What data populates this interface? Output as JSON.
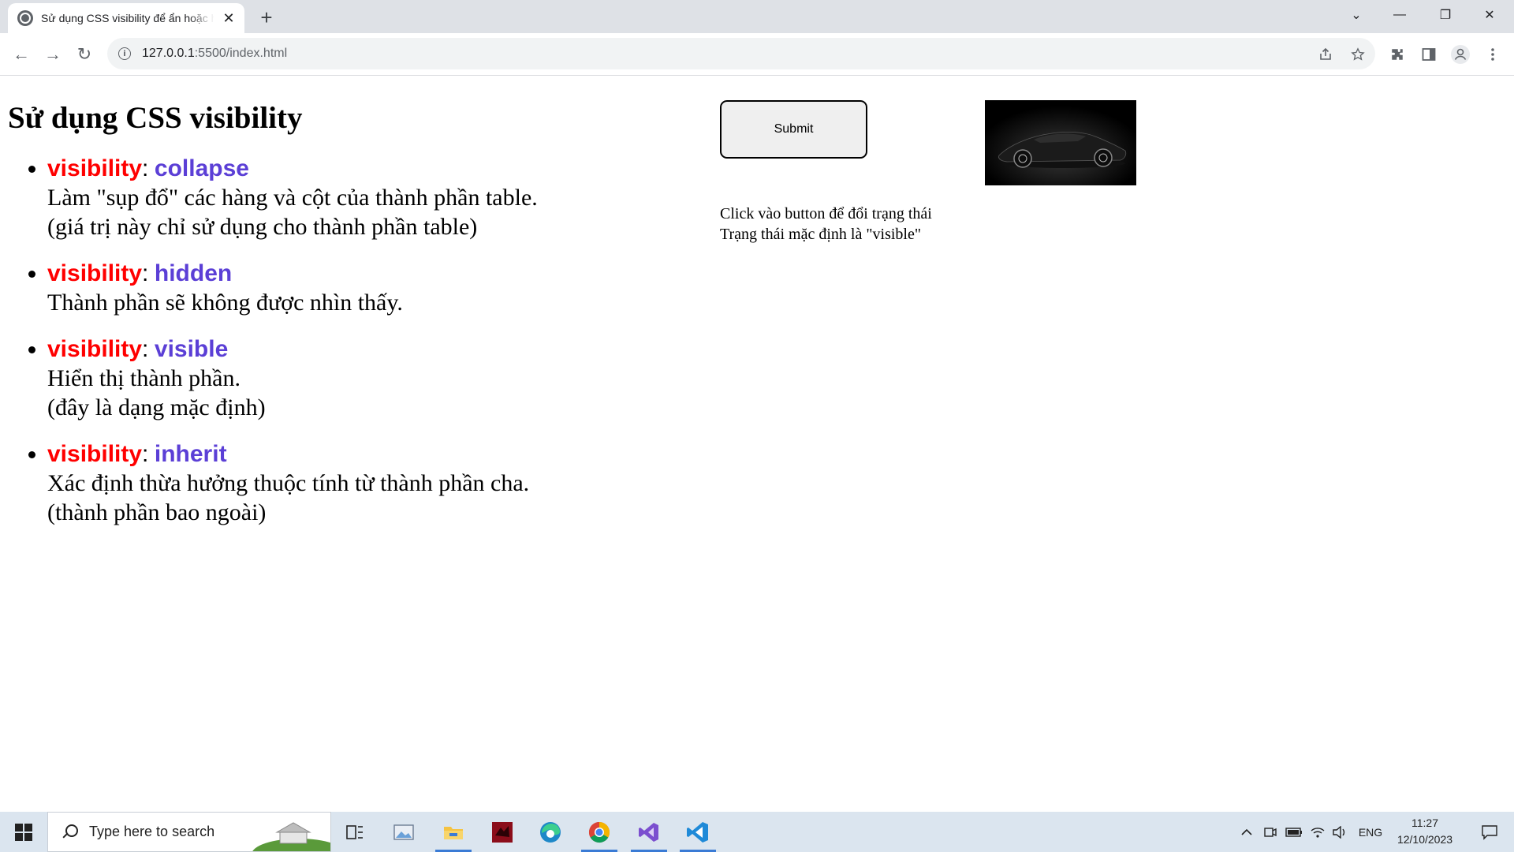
{
  "browser": {
    "tab_title": "Sử dụng CSS visibility để ẩn hoặc hiện thành phần",
    "tab_close": "✕",
    "new_tab": "+",
    "url_host": "127.0.0.1",
    "url_rest": ":5500/index.html",
    "window_controls": {
      "list": "⌄",
      "minimize": "—",
      "maximize": "❐",
      "close": "✕"
    },
    "nav": {
      "back": "←",
      "forward": "→",
      "reload": "↻"
    }
  },
  "page": {
    "title": "Sử dụng CSS visibility",
    "items": [
      {
        "prop": "visibility",
        "colon": ":",
        "value": "collapse",
        "line1": "Làm \"sụp đổ\" các hàng và cột của thành phần table.",
        "line2": "(giá trị này chỉ sử dụng cho thành phần table)"
      },
      {
        "prop": "visibility",
        "colon": ":",
        "value": "hidden",
        "line1": "Thành phần sẽ không được nhìn thấy.",
        "line2": ""
      },
      {
        "prop": "visibility",
        "colon": ":",
        "value": "visible",
        "line1": "Hiển thị thành phần.",
        "line2": "(đây là dạng mặc định)"
      },
      {
        "prop": "visibility",
        "colon": ":",
        "value": "inherit",
        "line1": "Xác định thừa hưởng thuộc tính từ thành phần cha.",
        "line2": "(thành phần bao ngoài)"
      }
    ],
    "submit_label": "Submit",
    "hint_line1": "Click vào button để đổi trạng thái",
    "hint_line2": "Trạng thái mặc định là \"visible\"",
    "colors": {
      "prop": "#ff0000",
      "value": "#5b3fd6"
    }
  },
  "taskbar": {
    "search_placeholder": "Type here to search",
    "language": "ENG",
    "time": "11:27",
    "date": "12/10/2023"
  }
}
